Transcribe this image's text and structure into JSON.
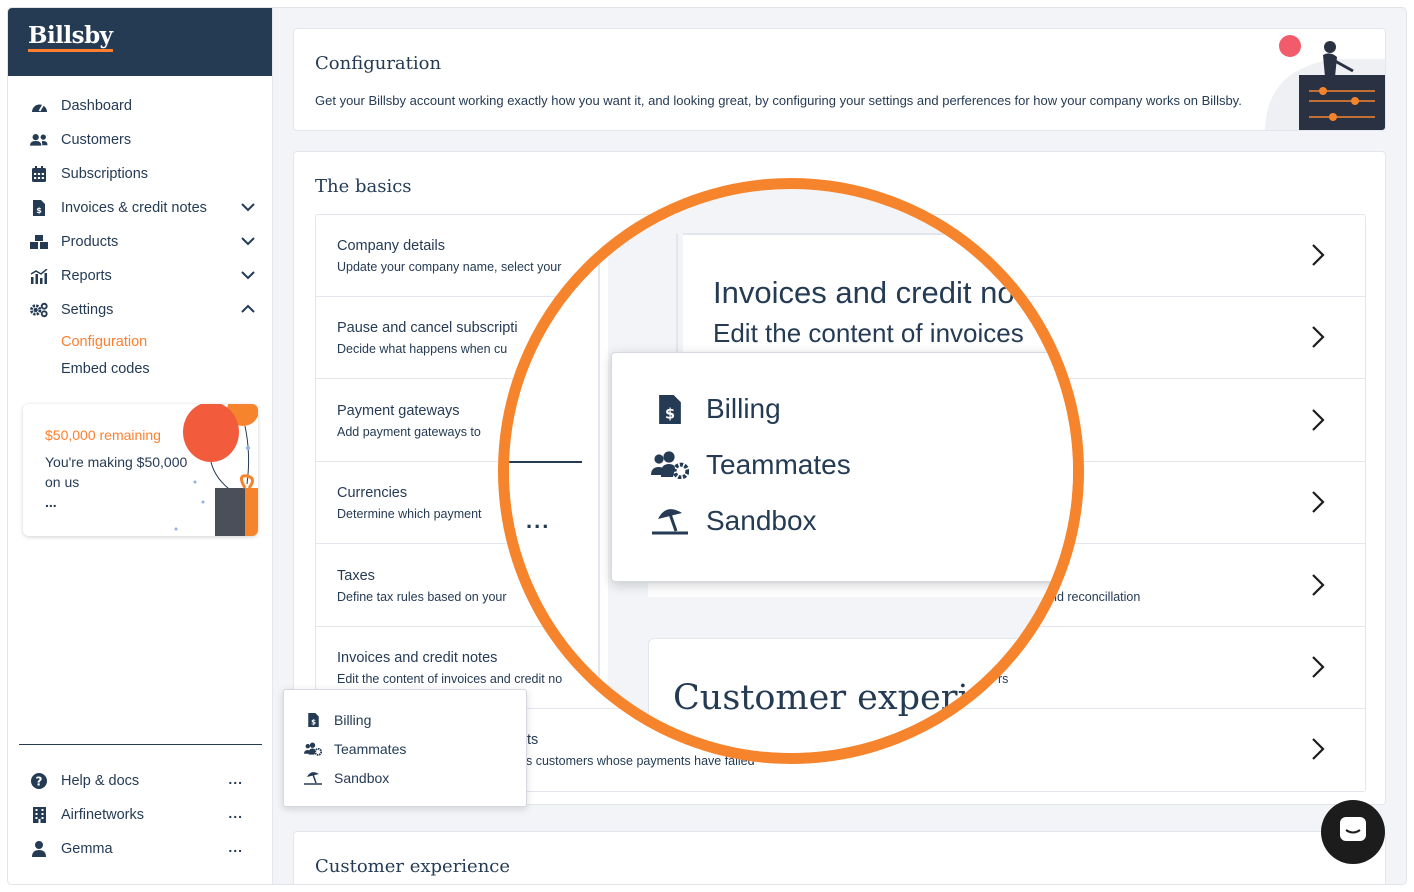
{
  "brand": {
    "name": "Billsby"
  },
  "sidebar": {
    "items": [
      {
        "label": "Dashboard",
        "icon": "dashboard-icon"
      },
      {
        "label": "Customers",
        "icon": "users-icon"
      },
      {
        "label": "Subscriptions",
        "icon": "calendar-icon"
      },
      {
        "label": "Invoices & credit notes",
        "icon": "invoice-icon",
        "chevron": "down"
      },
      {
        "label": "Products",
        "icon": "boxes-icon",
        "chevron": "down"
      },
      {
        "label": "Reports",
        "icon": "chart-icon",
        "chevron": "down"
      },
      {
        "label": "Settings",
        "icon": "cogs-icon",
        "chevron": "up"
      }
    ],
    "settings_sub": [
      {
        "label": "Configuration",
        "active": true
      },
      {
        "label": "Embed codes",
        "active": false
      }
    ],
    "promo": {
      "amount": "$50,000 remaining",
      "text": "You're making $50,000 on us",
      "more": "..."
    },
    "footer": [
      {
        "label": "Help & docs",
        "icon": "question-circle-icon",
        "more": "..."
      },
      {
        "label": "Airfinetworks",
        "icon": "building-icon",
        "more": "..."
      },
      {
        "label": "Gemma",
        "icon": "user-icon",
        "more": "..."
      }
    ]
  },
  "config": {
    "title": "Configuration",
    "description": "Get your Billsby account working exactly how you want it, and looking great, by configuring your settings and perferences for how your company works on Billsby."
  },
  "basics": {
    "title": "The basics",
    "rows": [
      {
        "title": "Company details",
        "desc": "Update your company name, select your"
      },
      {
        "title": "Pause and cancel subscripti",
        "desc": "Decide what happens when cu"
      },
      {
        "title": "Payment gateways",
        "desc": "Add payment gateways to"
      },
      {
        "title": "Currencies",
        "desc": "Determine which payment"
      },
      {
        "title": "Taxes",
        "desc": "Define tax rules based on your",
        "desc_tail": "nd reconcillation"
      },
      {
        "title": "Invoices and credit notes",
        "desc": "Edit the content of invoices and credit no",
        "desc_tail": "rs"
      },
      {
        "title": "ts",
        "desc": "s customers whose payments have failed"
      }
    ]
  },
  "customer_experience": {
    "title": "Customer experience"
  },
  "popup": {
    "items": [
      {
        "label": "Billing",
        "icon": "invoice-dollar-icon"
      },
      {
        "label": "Teammates",
        "icon": "users-cog-icon"
      },
      {
        "label": "Sandbox",
        "icon": "umbrella-beach-icon"
      }
    ]
  },
  "magnifier": {
    "row_title": "Invoices and credit no",
    "row_desc": "Edit the content of invoices",
    "customer_experience": "Customer experie",
    "dots": "..."
  },
  "colors": {
    "navy": "#253b54",
    "orange": "#fe7f2d",
    "magnifier_ring": "#f6842c",
    "background": "#f2f4f8"
  }
}
